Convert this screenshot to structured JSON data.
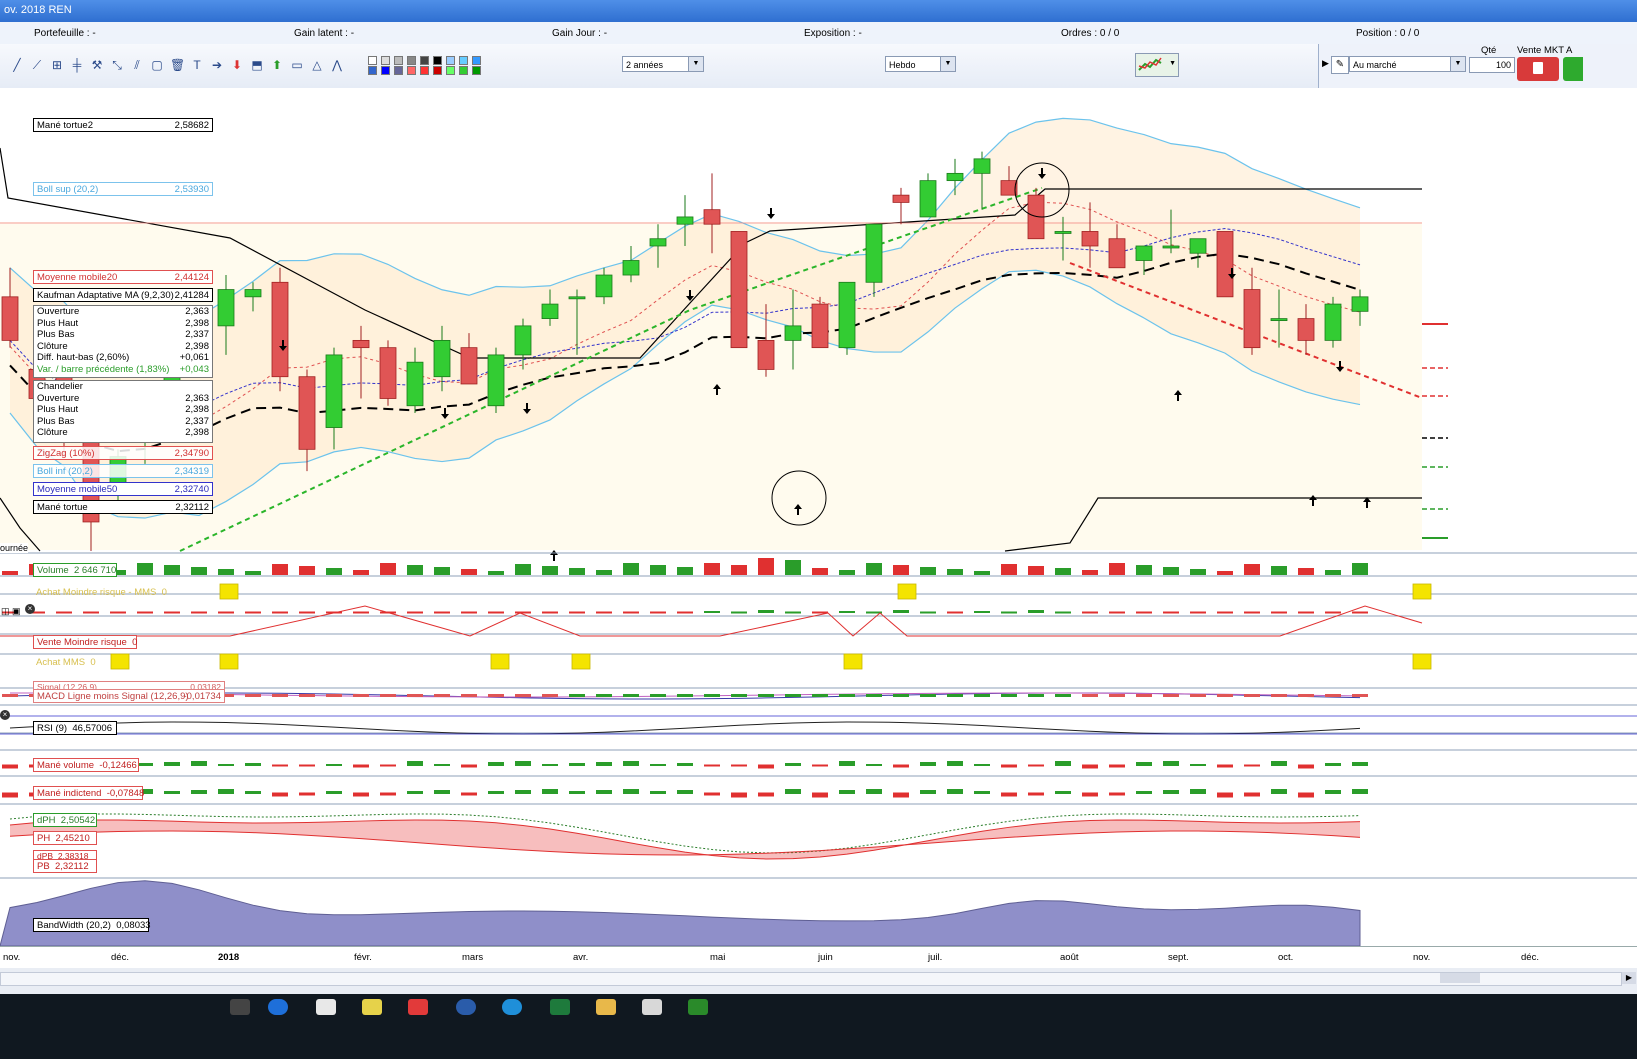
{
  "window": {
    "title": "ov. 2018 REN"
  },
  "infobar": {
    "portefeuille": "Portefeuille : -",
    "gain_latent": "Gain latent : -",
    "gain_jour": "Gain Jour : -",
    "exposition": "Exposition : -",
    "ordres": "Ordres : 0 / 0",
    "position": "Position : 0 / 0"
  },
  "toolbar": {
    "period_value": "2 années",
    "interval_value": "Hebdo",
    "order_type_value": "Au marché",
    "qty_label": "Qté",
    "qty_value": "100",
    "sell_label": "Vente MKT A"
  },
  "indicators": {
    "mane_tortue2": {
      "name": "Mané tortue2",
      "value": "2,58682"
    },
    "boll_sup": {
      "name": "Boll sup (20,2)",
      "value": "2,53930"
    },
    "mm20": {
      "name": "Moyenne mobile20",
      "value": "2,44124"
    },
    "kama": {
      "name": "Kaufman Adaptative MA (9,2,30)",
      "value": "2,41284"
    },
    "zigzag": {
      "name": "ZigZag (10%)",
      "value": "2,34790"
    },
    "boll_inf": {
      "name": "Boll inf (20,2)",
      "value": "2,34319"
    },
    "mm50": {
      "name": "Moyenne mobile50",
      "value": "2,32740"
    },
    "mane_tortue": {
      "name": "Mané tortue",
      "value": "2,32112"
    }
  },
  "ohlc_box": [
    {
      "label": "Ouverture",
      "value": "2,363"
    },
    {
      "label": "Plus Haut",
      "value": "2,398"
    },
    {
      "label": "Plus Bas",
      "value": "2,337"
    },
    {
      "label": "Clôture",
      "value": "2,398"
    },
    {
      "label": "Diff. haut-bas (2,60%)",
      "value": "+0,061"
    },
    {
      "label": "Var. / barre précédente (1,83%)",
      "value": "+0,043"
    }
  ],
  "chandelier_box": [
    {
      "label": "Chandelier",
      "value": ""
    },
    {
      "label": "Ouverture",
      "value": "2,363"
    },
    {
      "label": "Plus Haut",
      "value": "2,398"
    },
    {
      "label": "Plus Bas",
      "value": "2,337"
    },
    {
      "label": "Clôture",
      "value": "2,398"
    }
  ],
  "journee_label": "ournée",
  "panels": {
    "volume": {
      "name": "Volume",
      "value": "2 646 710"
    },
    "achat_moindre": {
      "name": "Achat Moindre risque - MMS",
      "value": "0"
    },
    "vente_moindre": {
      "name": "Vente Moindre risque",
      "value": "0"
    },
    "achat_mms": {
      "name": "Achat MMS",
      "value": "0"
    },
    "signal": {
      "name": "Signal (12,26,9)",
      "value": "0,03182"
    },
    "macd": {
      "name": "MACD Ligne moins Signal (12,26,9)",
      "value": "-0,01734"
    },
    "rsi": {
      "name": "RSI (9)",
      "value": "46,57006"
    },
    "mane_volume": {
      "name": "Mané volume",
      "value": "-0,12466"
    },
    "mane_indictend": {
      "name": "Mané indictend",
      "value": "-0,07848"
    },
    "dph": {
      "name": "dPH",
      "value": "2,50542"
    },
    "ph": {
      "name": "PH",
      "value": "2,45210"
    },
    "dpb": {
      "name": "dPB",
      "value": "2,38318"
    },
    "pb": {
      "name": "PB",
      "value": "2,32112"
    },
    "bandwidth": {
      "name": "BandWidth (20,2)",
      "value": "0,08033"
    }
  },
  "time_axis": [
    "nov.",
    "déc.",
    "2018",
    "févr.",
    "mars",
    "avr.",
    "mai",
    "juin",
    "juil.",
    "août",
    "sept.",
    "oct.",
    "nov.",
    "déc."
  ],
  "colors": {
    "up": "#33cc33",
    "down": "#e05555",
    "accent": "#2f6fd0"
  },
  "candles": [
    [
      2.4,
      2.44,
      2.33,
      2.34
    ],
    [
      2.3,
      2.35,
      2.22,
      2.26
    ],
    [
      2.29,
      2.37,
      2.18,
      2.24
    ],
    [
      2.21,
      2.26,
      2.05,
      2.09
    ],
    [
      2.14,
      2.19,
      2.11,
      2.18
    ],
    [
      2.2,
      2.27,
      2.17,
      2.24
    ],
    [
      2.26,
      2.32,
      2.24,
      2.31
    ],
    [
      2.33,
      2.36,
      2.3,
      2.33
    ],
    [
      2.36,
      2.43,
      2.32,
      2.41
    ],
    [
      2.4,
      2.42,
      2.38,
      2.41
    ],
    [
      2.42,
      2.44,
      2.27,
      2.29
    ],
    [
      2.29,
      2.3,
      2.16,
      2.19
    ],
    [
      2.22,
      2.33,
      2.19,
      2.32
    ],
    [
      2.34,
      2.36,
      2.26,
      2.33
    ],
    [
      2.33,
      2.34,
      2.25,
      2.26
    ],
    [
      2.25,
      2.33,
      2.24,
      2.31
    ],
    [
      2.29,
      2.36,
      2.27,
      2.34
    ],
    [
      2.33,
      2.35,
      2.28,
      2.28
    ],
    [
      2.25,
      2.33,
      2.24,
      2.32
    ],
    [
      2.32,
      2.37,
      2.3,
      2.36
    ],
    [
      2.37,
      2.41,
      2.36,
      2.39
    ],
    [
      2.4,
      2.41,
      2.32,
      2.4
    ],
    [
      2.4,
      2.44,
      2.39,
      2.43
    ],
    [
      2.43,
      2.47,
      2.42,
      2.45
    ],
    [
      2.47,
      2.5,
      2.44,
      2.48
    ],
    [
      2.5,
      2.54,
      2.47,
      2.51
    ],
    [
      2.52,
      2.57,
      2.46,
      2.5
    ],
    [
      2.49,
      2.49,
      2.33,
      2.33
    ],
    [
      2.34,
      2.39,
      2.29,
      2.3
    ],
    [
      2.34,
      2.41,
      2.3,
      2.36
    ],
    [
      2.39,
      2.4,
      2.33,
      2.33
    ],
    [
      2.33,
      2.42,
      2.32,
      2.42
    ],
    [
      2.42,
      2.5,
      2.4,
      2.5
    ],
    [
      2.54,
      2.55,
      2.5,
      2.53
    ],
    [
      2.51,
      2.57,
      2.51,
      2.56
    ],
    [
      2.56,
      2.59,
      2.54,
      2.57
    ],
    [
      2.57,
      2.6,
      2.52,
      2.59
    ],
    [
      2.56,
      2.58,
      2.54,
      2.54
    ],
    [
      2.54,
      2.55,
      2.48,
      2.48
    ],
    [
      2.49,
      2.51,
      2.45,
      2.49
    ],
    [
      2.49,
      2.53,
      2.44,
      2.47
    ],
    [
      2.48,
      2.5,
      2.44,
      2.44
    ],
    [
      2.45,
      2.47,
      2.43,
      2.47
    ],
    [
      2.47,
      2.52,
      2.46,
      2.47
    ],
    [
      2.46,
      2.48,
      2.44,
      2.48
    ],
    [
      2.49,
      2.49,
      2.4,
      2.4
    ],
    [
      2.41,
      2.44,
      2.32,
      2.33
    ],
    [
      2.37,
      2.41,
      2.33,
      2.37
    ],
    [
      2.37,
      2.39,
      2.32,
      2.34
    ],
    [
      2.34,
      2.4,
      2.33,
      2.39
    ],
    [
      2.38,
      2.41,
      2.36,
      2.4
    ]
  ]
}
